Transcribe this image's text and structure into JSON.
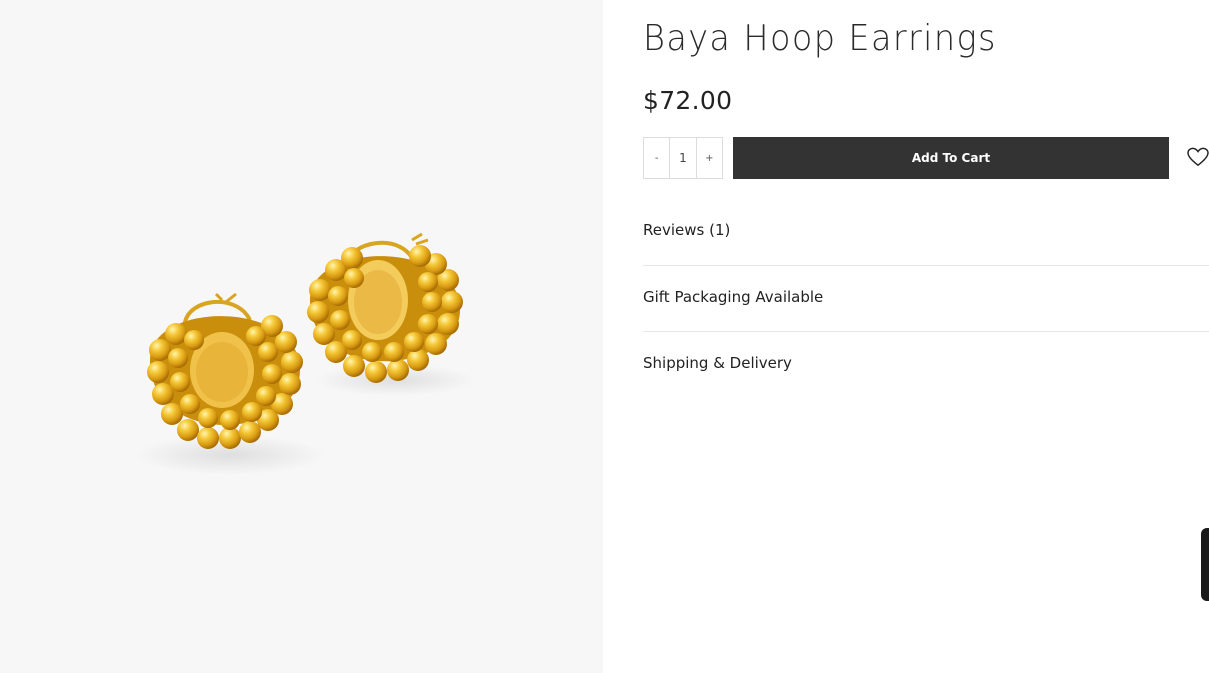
{
  "product": {
    "title": "Baya Hoop Earrings",
    "price": "$72.00",
    "image_alt": "gold-beaded-hoop-earrings"
  },
  "quantity": {
    "decrement": "-",
    "value": "1",
    "increment": "+"
  },
  "actions": {
    "add_to_cart": "Add To Cart",
    "wishlist_icon": "heart-icon"
  },
  "accordion": [
    {
      "label": "Reviews (1)"
    },
    {
      "label": "Gift Packaging Available"
    },
    {
      "label": "Shipping & Delivery"
    }
  ],
  "colors": {
    "gallery_bg": "#f7f7f7",
    "button_bg": "#333333",
    "gold": "#e6b12a",
    "side_tab": "#1a1a1a"
  }
}
